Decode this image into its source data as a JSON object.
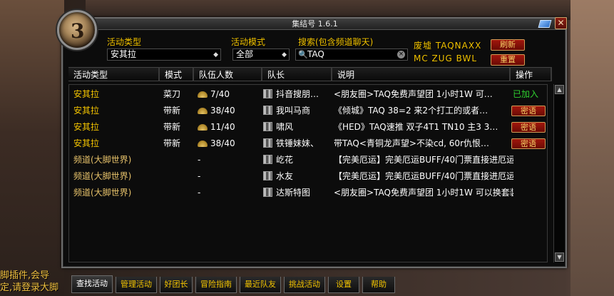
{
  "window": {
    "title": "集结号 1.6.1"
  },
  "chat_overlay": {
    "lines": [
      "脚插件,会导",
      "定,请登录大脚"
    ]
  },
  "filters": {
    "activity_type_label": "活动类型",
    "activity_type_value": "安其拉",
    "activity_mode_label": "活动模式",
    "activity_mode_value": "全部",
    "search_label": "搜索(包含频道聊天)",
    "search_value": "TAQ",
    "quick_tags_line1": "废墟 TAQNAXX",
    "quick_tags_line2": "MC ZUG BWL",
    "refresh_label": "刷新",
    "reset_label": "重置"
  },
  "table": {
    "headers": [
      "活动类型",
      "模式",
      "队伍人数",
      "队长",
      "说明",
      "操作"
    ],
    "rows": [
      {
        "type": "安其拉",
        "mode": "菜刀",
        "size": "7/40",
        "has_size": true,
        "leader": "抖音搜朋…",
        "desc": "<朋友圈>TAQ免费声望团 1小时1W 可…",
        "op": "已加入",
        "op_kind": "joined"
      },
      {
        "type": "安其拉",
        "mode": "带新",
        "size": "38/40",
        "has_size": true,
        "leader": "我叫马商",
        "desc": "《倾城》TAQ 38=2 来2个打工的或者…",
        "op": "密语",
        "op_kind": "whisper"
      },
      {
        "type": "安其拉",
        "mode": "带新",
        "size": "11/40",
        "has_size": true,
        "leader": "啸风",
        "desc": "《HED》TAQ速推 双子4T1 TN10 主3 3…",
        "op": "密语",
        "op_kind": "whisper"
      },
      {
        "type": "安其拉",
        "mode": "带新",
        "size": "38/40",
        "has_size": true,
        "leader": "铁锤妹妹、",
        "desc": "带TAQ<青铜龙声望>不染cd, 60r仇恨…",
        "op": "密语",
        "op_kind": "whisper"
      },
      {
        "type": "频道(大脚世界)",
        "mode": "",
        "size": "-",
        "has_size": false,
        "leader": "屹花",
        "desc": "【完美厄运】完美厄运BUFF/40门票直接进厄运…",
        "op": "",
        "op_kind": "none"
      },
      {
        "type": "频道(大脚世界)",
        "mode": "",
        "size": "-",
        "has_size": false,
        "leader": "水友",
        "desc": "【完美厄运】完美厄运BUFF/40门票直接进厄运…",
        "op": "",
        "op_kind": "none"
      },
      {
        "type": "频道(大脚世界)",
        "mode": "",
        "size": "-",
        "has_size": false,
        "leader": "达斯特图",
        "desc": "<朋友圈>TAQ免费声望团 1小时1W 可以换套装…",
        "op": "",
        "op_kind": "none"
      }
    ]
  },
  "tabs": [
    "查找活动",
    "管理活动",
    "好团长",
    "冒险指南",
    "最近队友",
    "挑战活动",
    "设置",
    "帮助"
  ],
  "active_tab": 0,
  "colors": {
    "accent_yellow": "#f2c300",
    "joined_green": "#2fd12f",
    "button_red": "#a0160c"
  }
}
